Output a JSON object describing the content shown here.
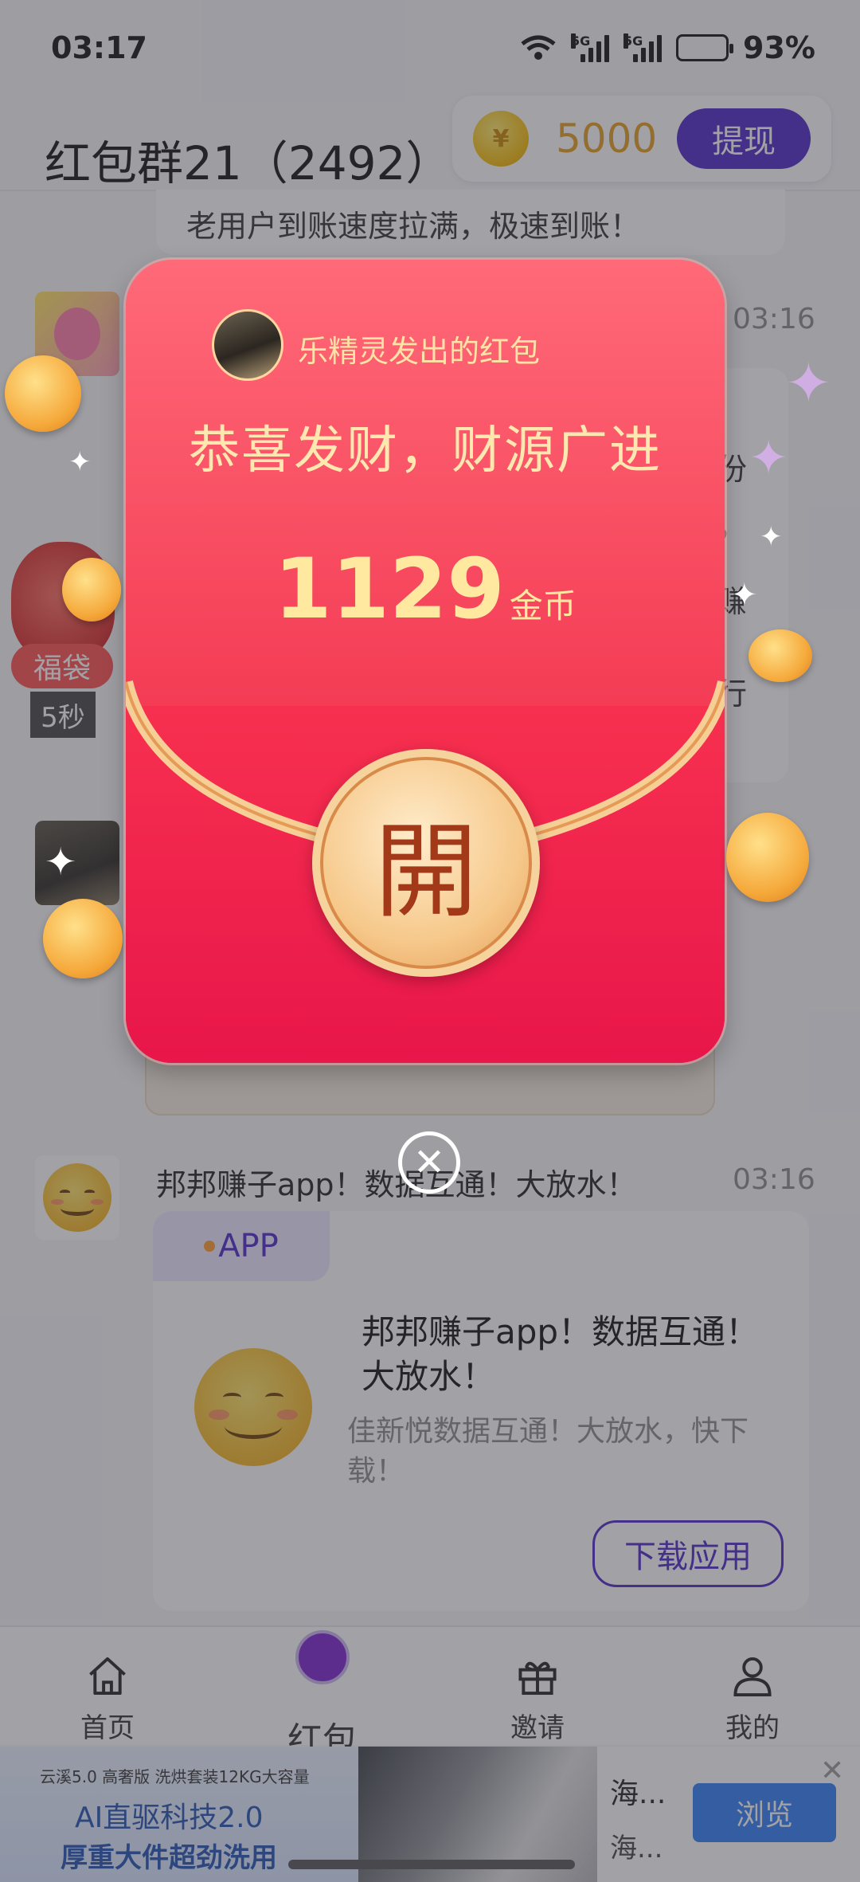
{
  "status_bar": {
    "time": "03:17",
    "signal1_label": "5G",
    "signal2_label": "5G",
    "battery": "93%"
  },
  "header": {
    "group_title": "红包群21（2492）",
    "coin_symbol": "¥",
    "coin_count": "5000",
    "withdraw_label": "提现"
  },
  "chat": {
    "top_message": "老用户到账速度拉满，极速到账！",
    "timestamp_1": "03:16",
    "partial_chars": [
      "份",
      "，",
      "赚",
      "行"
    ],
    "fudai": {
      "label": "福袋",
      "timer": "5秒"
    },
    "app_message": {
      "title": "邦邦赚子app！数据互通！大放水！",
      "timestamp": "03:16",
      "badge": "APP",
      "app_name": "邦邦赚子app！数据互通！大放水！",
      "description": "佳新悦数据互通！大放水，快下载！",
      "download_label": "下载应用"
    }
  },
  "bottom_nav": {
    "items": [
      {
        "label": "首页"
      },
      {
        "label": "红包"
      },
      {
        "label": "邀请"
      },
      {
        "label": "我的"
      }
    ]
  },
  "ad": {
    "brand": "云溪5.0 高奢版 洗烘套装12KG大容量",
    "line1": "AI直驱科技2.0",
    "line2": "厚重大件超劲洗用",
    "title": "海...",
    "subtitle": "海...",
    "button": "浏览",
    "close": "✕"
  },
  "red_packet": {
    "sender": "乐精灵发出的红包",
    "wish": "恭喜发财，财源广进",
    "amount": "1129",
    "unit": "金币",
    "open_label": "開",
    "close_icon": "✕"
  },
  "colors": {
    "accent": "#4b24c8",
    "packet_red": "#f43c55",
    "gold": "#ffe9a0"
  }
}
